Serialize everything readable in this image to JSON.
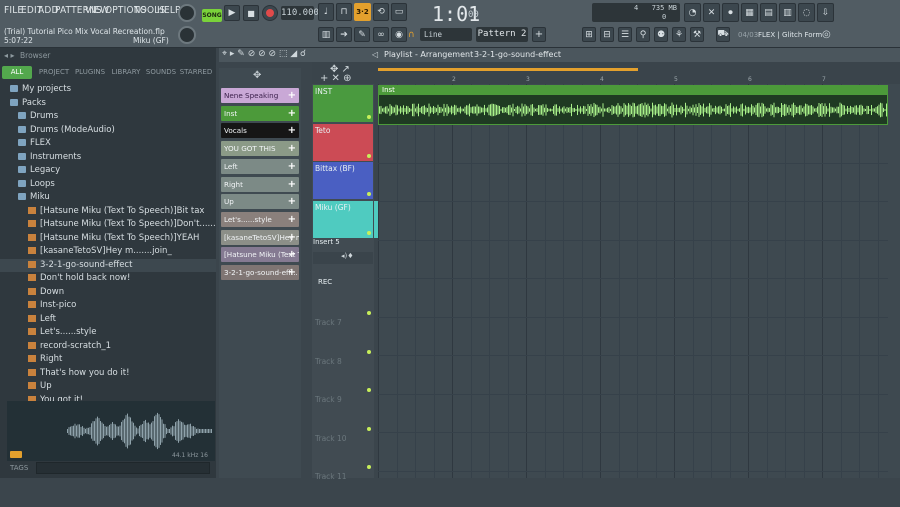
{
  "menu": [
    "FILE",
    "EDIT",
    "ADD",
    "PATTERNS",
    "VIEW",
    "OPTIONS",
    "TOOLS",
    "HELP"
  ],
  "project": {
    "title": "(Trial) Tutorial Pico Mix Vocal Recreation.flp",
    "time": "5:07:22",
    "channel": "Miku (GF)"
  },
  "transport": {
    "mode": "SONG",
    "tempo": "110.000",
    "time": "1:01",
    "time_small": "00",
    "pattern": "Pattern 2",
    "snap": "Line"
  },
  "monitor": {
    "cpu": "4",
    "memory": "735 MB",
    "voices": "0"
  },
  "news": {
    "date": "04/03",
    "text": "FLEX | Glitch Form"
  },
  "browser": {
    "title": "Browser",
    "tabs": [
      "ALL",
      "PROJECT",
      "PLUGINS",
      "LIBRARY",
      "SOUNDS",
      "STARRED"
    ],
    "items": [
      {
        "label": "My projects",
        "type": "root"
      },
      {
        "label": "Packs",
        "type": "root"
      },
      {
        "label": "Drums",
        "type": "folder"
      },
      {
        "label": "Drums (ModeAudio)",
        "type": "folder"
      },
      {
        "label": "FLEX",
        "type": "folder"
      },
      {
        "label": "Instruments",
        "type": "folder"
      },
      {
        "label": "Legacy",
        "type": "folder"
      },
      {
        "label": "Loops",
        "type": "folder"
      },
      {
        "label": "Miku",
        "type": "folder"
      },
      {
        "label": "[Hatsune Miku (Text To Speech)]Bit tax",
        "type": "file"
      },
      {
        "label": "[Hatsune Miku (Text To Speech)]Don't.......ings!",
        "type": "file"
      },
      {
        "label": "[Hatsune Miku (Text To Speech)]YEAH",
        "type": "file"
      },
      {
        "label": "[kasaneTetoSV]Hey m.......join_",
        "type": "file"
      },
      {
        "label": "3-2-1-go-sound-effect",
        "type": "file"
      },
      {
        "label": "Don't hold back now!",
        "type": "file"
      },
      {
        "label": "Down",
        "type": "file"
      },
      {
        "label": "Inst-pico",
        "type": "file"
      },
      {
        "label": "Left",
        "type": "file"
      },
      {
        "label": "Let's......style",
        "type": "file"
      },
      {
        "label": "record-scratch_1",
        "type": "file"
      },
      {
        "label": "Right",
        "type": "file"
      },
      {
        "label": "That's how you do it!",
        "type": "file"
      },
      {
        "label": "Up",
        "type": "file"
      },
      {
        "label": "You got it!",
        "type": "file"
      }
    ],
    "preview_info": "44.1 kHz 16",
    "tags_label": "TAGS"
  },
  "rack": {
    "channels": [
      {
        "label": "Nene Speaking",
        "color": "#c9a8d6"
      },
      {
        "label": "Inst",
        "color": "#4c9a3a"
      },
      {
        "label": "Vocals",
        "color": "#161616"
      },
      {
        "label": "YOU GOT THIS",
        "color": "#8b9a87"
      },
      {
        "label": "Left",
        "color": "#7c8a86"
      },
      {
        "label": "Right",
        "color": "#7c8a86"
      },
      {
        "label": "Up",
        "color": "#7c8a86"
      },
      {
        "label": "Let's......style",
        "color": "#8a807c"
      },
      {
        "label": "[kasaneTetoSV]Hey m...",
        "color": "#8c8f88"
      },
      {
        "label": "[Hatsune Miku (Text T...",
        "color": "#857a92"
      },
      {
        "label": "3-2-1-go-sound-eff...",
        "color": "#7f7573"
      }
    ]
  },
  "playlist": {
    "title": "Playlist - Arrangement",
    "pattern": "3-2-1-go-sound-effect",
    "ruler": [
      "2",
      "3",
      "4",
      "5",
      "6",
      "7"
    ],
    "tracks": [
      {
        "label": "INST",
        "color": "#4a9a3f"
      },
      {
        "label": "Teto",
        "color": "#cc4b55"
      },
      {
        "label": "Bittax (BF)",
        "color": "#4a5fc2"
      },
      {
        "label": "Miku (GF)",
        "color": "#4fcbc0"
      }
    ],
    "insert_label": "Insert 5",
    "rec_label": "REC",
    "empty_tracks": [
      "Track 7",
      "Track 8",
      "Track 9",
      "Track 10",
      "Track 11"
    ],
    "clip_label": "Inst"
  }
}
